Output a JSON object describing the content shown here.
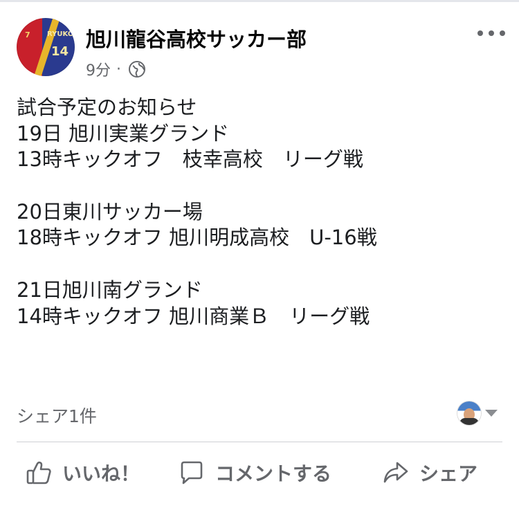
{
  "post": {
    "page_name": "旭川龍谷高校サッカー部",
    "timestamp": "9分",
    "separator": "·",
    "audience_icon": "globe-icon",
    "more_icon": "more-horizontal-icon",
    "body_lines": [
      "試合予定のお知らせ",
      "19日 旭川実業グランド",
      "13時キックオフ　枝幸高校　リーグ戦",
      "",
      "20日東川サッカー場",
      "18時キックオフ 旭川明成高校　U-16戦",
      "",
      "21日旭川南グランド",
      "14時キックオフ 旭川商業Ｂ　リーグ戦"
    ]
  },
  "avatar": {
    "jersey_number_left": "7",
    "jersey_name": "RYUKOK",
    "jersey_number_right": "14"
  },
  "stats": {
    "shares_label": "シェア1件"
  },
  "actions": {
    "like_label": "いいね！",
    "comment_label": "コメントする",
    "share_label": "シェア"
  },
  "colors": {
    "text_primary": "#050505",
    "text_secondary": "#65676b",
    "divider": "#ced0d4"
  }
}
